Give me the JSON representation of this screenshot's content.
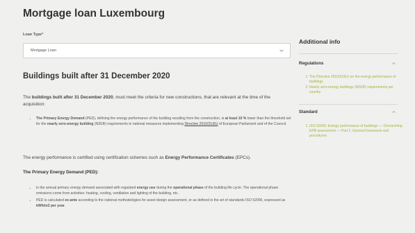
{
  "page": {
    "title": "Mortgage loan Luxembourg"
  },
  "loan_type": {
    "label": "Loan Type",
    "required_mark": "*",
    "selected": "Mortgage Loan",
    "chevron_icon": "chevron-down-icon"
  },
  "main": {
    "section_title": "Buildings built after 31 December 2020",
    "intro": {
      "pre": "The ",
      "bold": "buildings built after 31 December 2020",
      "post": ", must meet the criteria for new constructions, that are relevant at the time of the acquisition:"
    },
    "bullet1": {
      "bold1": "The Primary Energy Demand",
      "t1": " (PED), defining the energy performance of the building resulting from the construction, is ",
      "bold2": "at least 10 %",
      "t2": " lower than the threshold set for the ",
      "bold3": "nearly zero-energy building",
      "t3": " (NZEB) requirements in national measures implementing ",
      "link": "Directive 2010/31/EU",
      "t4": " of European Parliament and of the Council."
    },
    "certified": {
      "pre": "The energy performance is certified using certification schemes such as ",
      "bold": "Energy Performance Certificates",
      "post": " (EPCs)."
    },
    "ped_heading": {
      "bold": "The Primary Energy Demand",
      "post": " (PED):"
    },
    "bullet2": {
      "t1": "Is the annual primary energy demand associated with regulated ",
      "bold1": "energy use",
      "t2": " during the ",
      "bold2": "operational phase",
      "t3": " of the building life cycle. The operational phase emissions come from activities: heating, cooling, ventilation and lighting of the building, etc."
    },
    "bullet3": {
      "t1": "PED is calculated ",
      "bold1": "ex-ante",
      "t2": " according to the national methodologies for asset design assessment, or as defined in the art of standards ISO 52000, expressed as ",
      "bold2": "kWh/m2 per year",
      "t3": "."
    }
  },
  "sidebar": {
    "title": "Additional info",
    "sections": [
      {
        "title": "Regulations",
        "caret_icon": "chevron-up-icon",
        "items": [
          "The Directive 2010/31/EU on the energy performance of buildings",
          "Nearly zero-energy buildings (NZEB) requirements per country"
        ]
      },
      {
        "title": "Standard",
        "caret_icon": "chevron-up-icon",
        "items": [
          "ISO 52000: Energy performance of buildings — Overarching EPB assessment — Part 1: General framework and procedures"
        ]
      }
    ]
  },
  "colors": {
    "background": "#f0f0ef",
    "link_accent": "#a9b03a",
    "text": "#3a3a3a"
  }
}
